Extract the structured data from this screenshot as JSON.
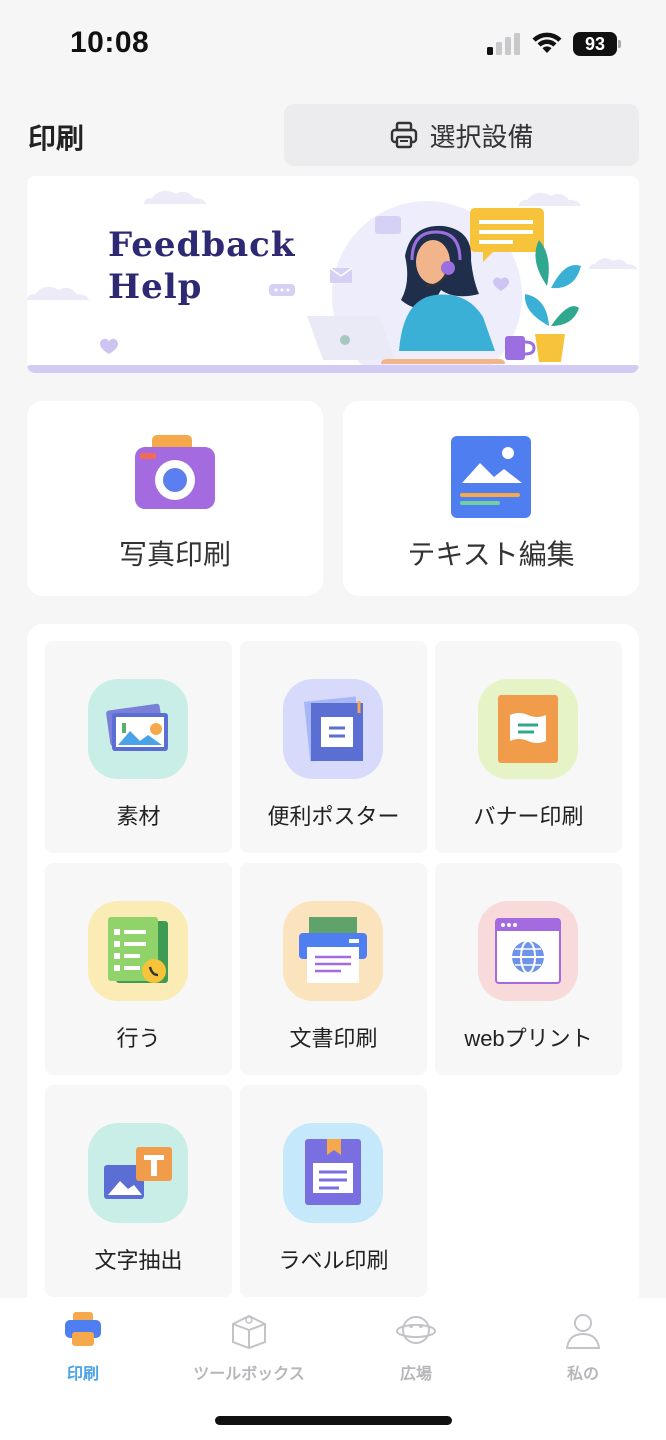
{
  "status_bar": {
    "time": "10:08",
    "battery": "93"
  },
  "header": {
    "title": "印刷",
    "select_device_label": "選択設備"
  },
  "banner": {
    "line1": "Feedback",
    "line2": "Help"
  },
  "quick_actions": [
    {
      "label": "写真印刷",
      "icon": "camera-icon"
    },
    {
      "label": "テキスト編集",
      "icon": "image-document-icon"
    }
  ],
  "tools": [
    {
      "label": "素材",
      "icon": "material-photos-icon",
      "bg": "#c9eee7"
    },
    {
      "label": "便利ポスター",
      "icon": "poster-icon",
      "bg": "#d7dafb"
    },
    {
      "label": "バナー印刷",
      "icon": "banner-icon",
      "bg": "#e6f3c6"
    },
    {
      "label": "行う",
      "icon": "todo-list-icon",
      "bg": "#fbecb6"
    },
    {
      "label": "文書印刷",
      "icon": "document-print-icon",
      "bg": "#fbe3bd"
    },
    {
      "label": "webプリント",
      "icon": "web-print-icon",
      "bg": "#f8dada"
    },
    {
      "label": "文字抽出",
      "icon": "text-extract-icon",
      "bg": "#c9eee7"
    },
    {
      "label": "ラベル印刷",
      "icon": "label-print-icon",
      "bg": "#c6e8fb"
    }
  ],
  "bottom_nav": [
    {
      "label": "印刷",
      "icon": "printer-nav-icon",
      "active": true
    },
    {
      "label": "ツールボックス",
      "icon": "toolbox-icon",
      "active": false
    },
    {
      "label": "広場",
      "icon": "planet-icon",
      "active": false
    },
    {
      "label": "私の",
      "icon": "person-icon",
      "active": false
    }
  ],
  "colors": {
    "accent": "#4aa3e8",
    "banner_text": "#2d2a73",
    "inactive_nav": "#b7b7bb"
  }
}
